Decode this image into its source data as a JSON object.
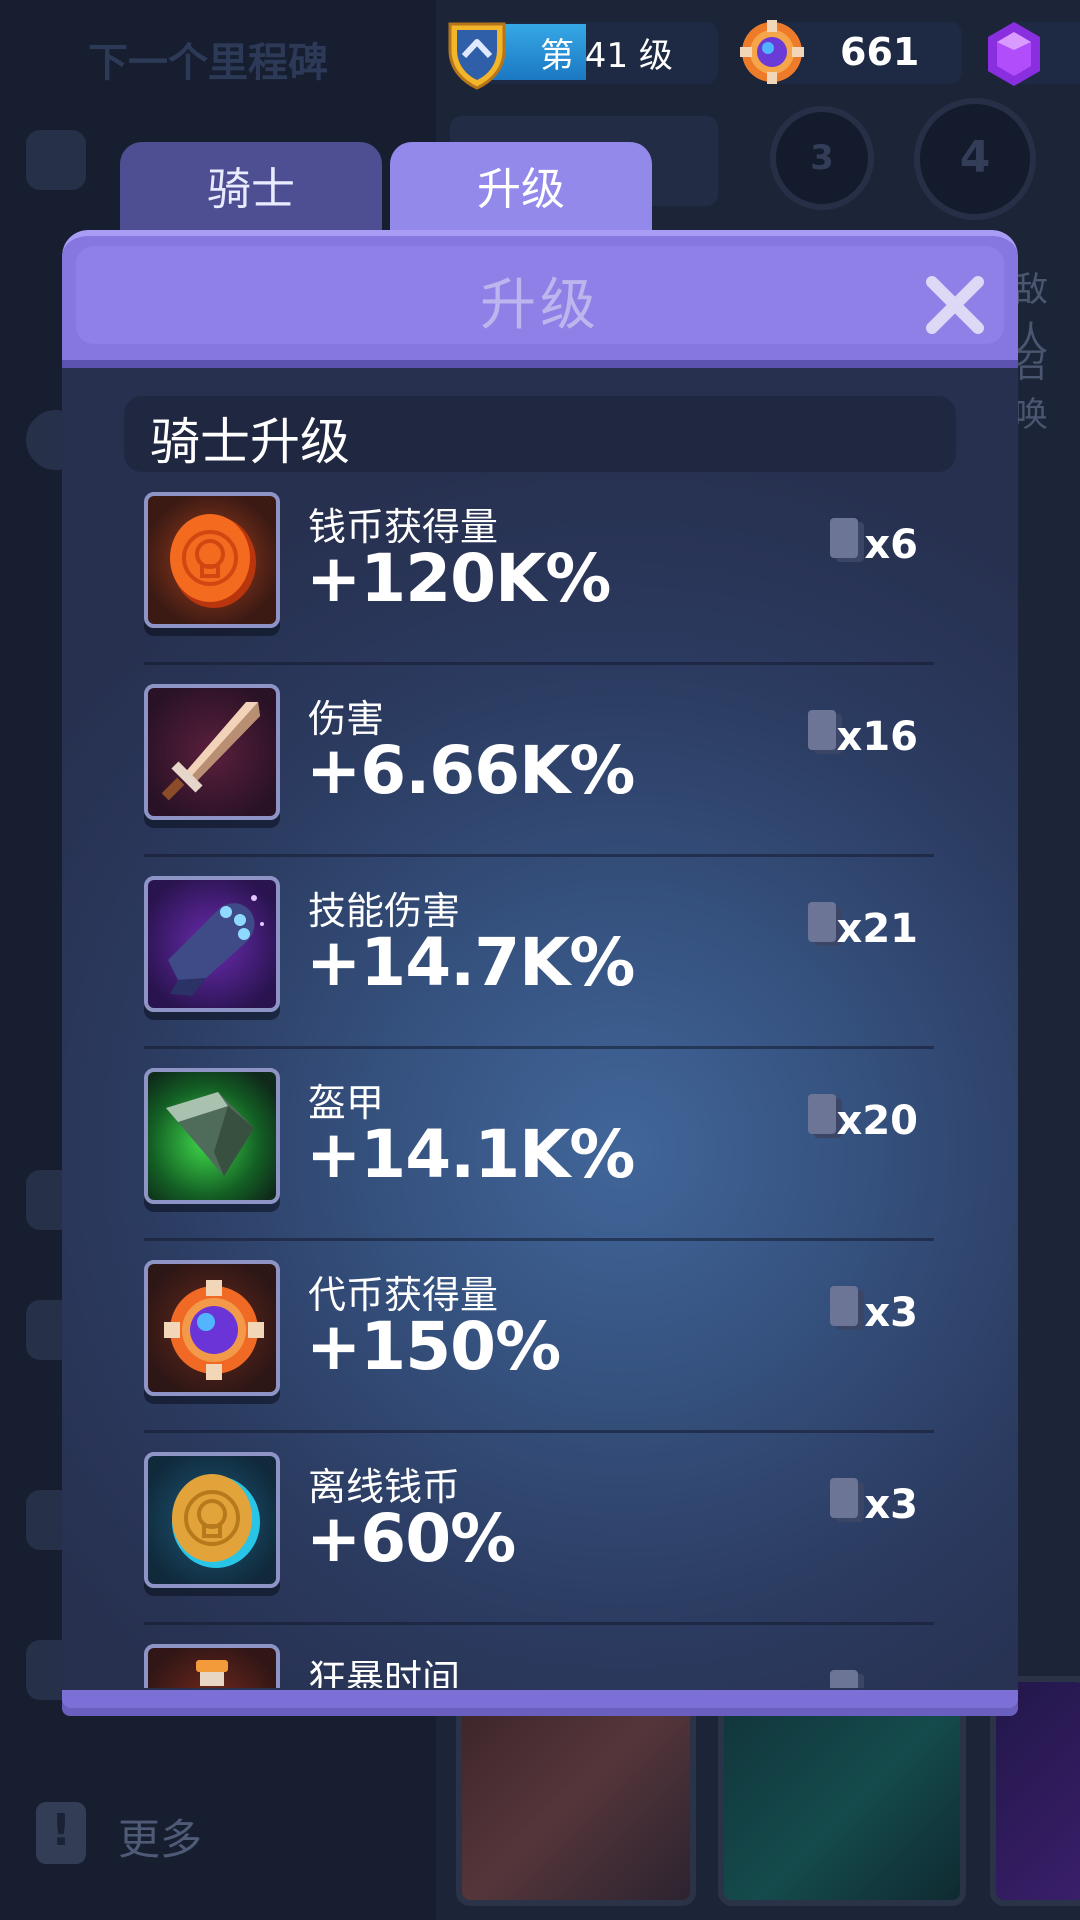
{
  "background": {
    "next_title": "下一个里程碑",
    "more_label": "更多",
    "stage_numbers": [
      "3",
      "4"
    ],
    "right_texts": [
      "敌人",
      "召唤"
    ]
  },
  "hud": {
    "level_label": "第 41 级",
    "token_count": "661"
  },
  "tabs": [
    {
      "label": "骑士"
    },
    {
      "label": "升级"
    }
  ],
  "modal": {
    "title": "升级",
    "section_title": "骑士升级"
  },
  "upgrades": [
    {
      "name": "钱币获得量",
      "value": "+120K%",
      "count": "x6",
      "icon": "gold-coin-icon"
    },
    {
      "name": "伤害",
      "value": "+6.66K%",
      "count": "x16",
      "icon": "sword-icon"
    },
    {
      "name": "技能伤害",
      "value": "+14.7K%",
      "count": "x21",
      "icon": "gauntlet-icon"
    },
    {
      "name": "盔甲",
      "value": "+14.1K%",
      "count": "x20",
      "icon": "armor-plate-icon"
    },
    {
      "name": "代币获得量",
      "value": "+150%",
      "count": "x3",
      "icon": "token-icon"
    },
    {
      "name": "离线钱币",
      "value": "+60%",
      "count": "x3",
      "icon": "offline-coin-icon"
    },
    {
      "name": "狂暴时间",
      "value": "",
      "count": "",
      "icon": "potion-icon"
    }
  ]
}
